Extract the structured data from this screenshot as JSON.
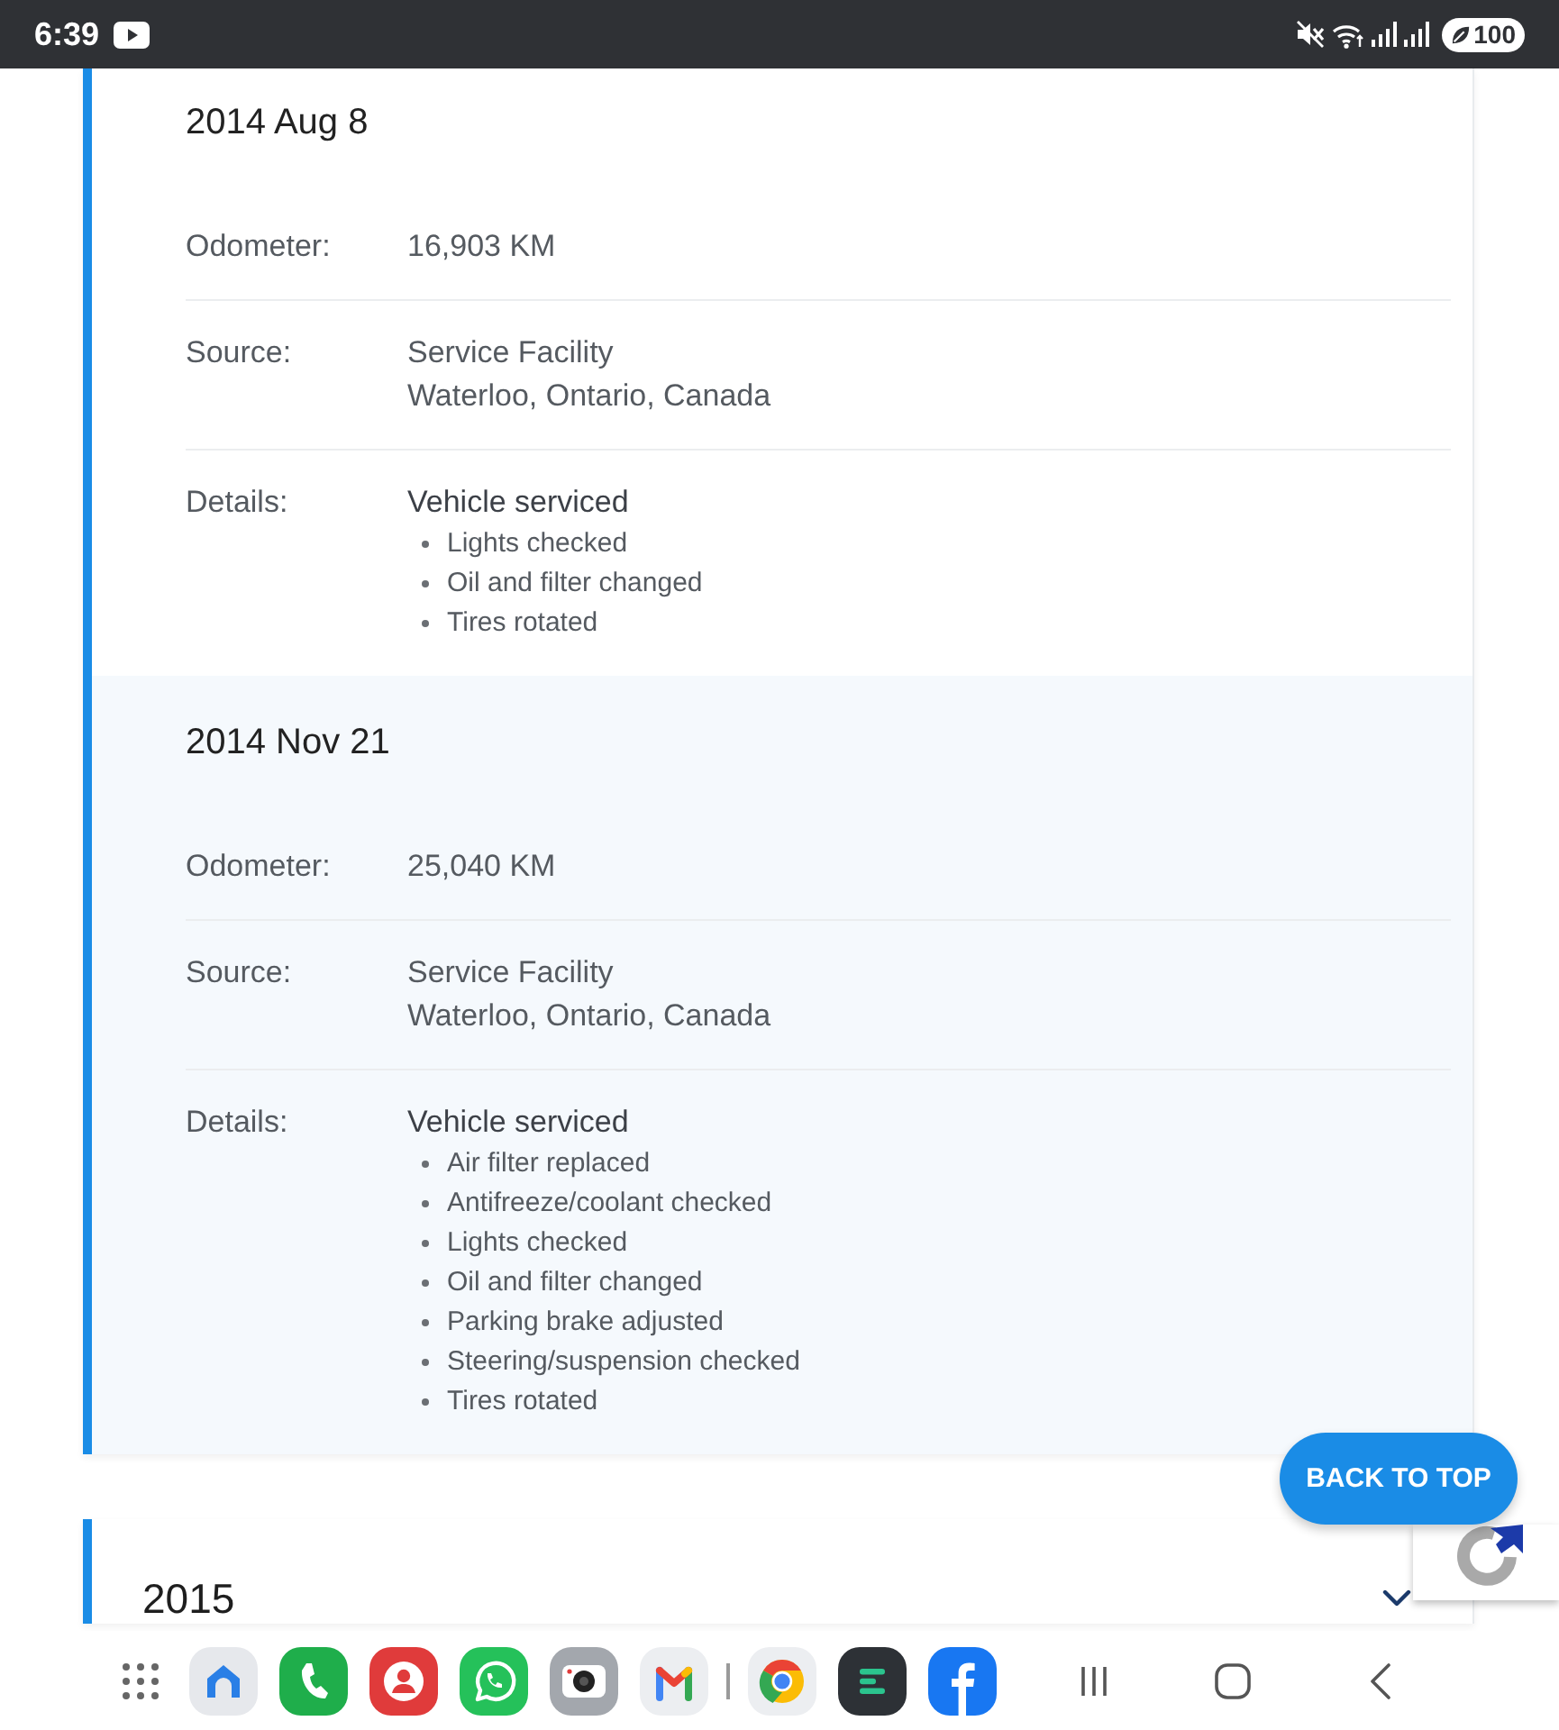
{
  "status_bar": {
    "time": "6:39",
    "battery": "100"
  },
  "service_card": {
    "records": [
      {
        "date": "2014 Aug 8",
        "fields": [
          {
            "kind": "text",
            "label": "Odometer:",
            "lines": [
              "16,903 KM"
            ]
          },
          {
            "kind": "text",
            "label": "Source:",
            "lines": [
              "Service Facility",
              "Waterloo, Ontario, Canada"
            ]
          },
          {
            "kind": "list",
            "label": "Details:",
            "heading": "Vehicle serviced",
            "items": [
              "Lights checked",
              "Oil and filter changed",
              "Tires rotated"
            ]
          }
        ]
      },
      {
        "date": "2014 Nov 21",
        "fields": [
          {
            "kind": "text",
            "label": "Odometer:",
            "lines": [
              "25,040 KM"
            ]
          },
          {
            "kind": "text",
            "label": "Source:",
            "lines": [
              "Service Facility",
              "Waterloo, Ontario, Canada"
            ]
          },
          {
            "kind": "list",
            "label": "Details:",
            "heading": "Vehicle serviced",
            "items": [
              "Air filter replaced",
              "Antifreeze/coolant checked",
              "Lights checked",
              "Oil and filter changed",
              "Parking brake adjusted",
              "Steering/suspension checked",
              "Tires rotated"
            ]
          }
        ]
      }
    ]
  },
  "year_section": {
    "year": "2015",
    "expanded": false
  },
  "back_to_top": "BACK TO TOP"
}
